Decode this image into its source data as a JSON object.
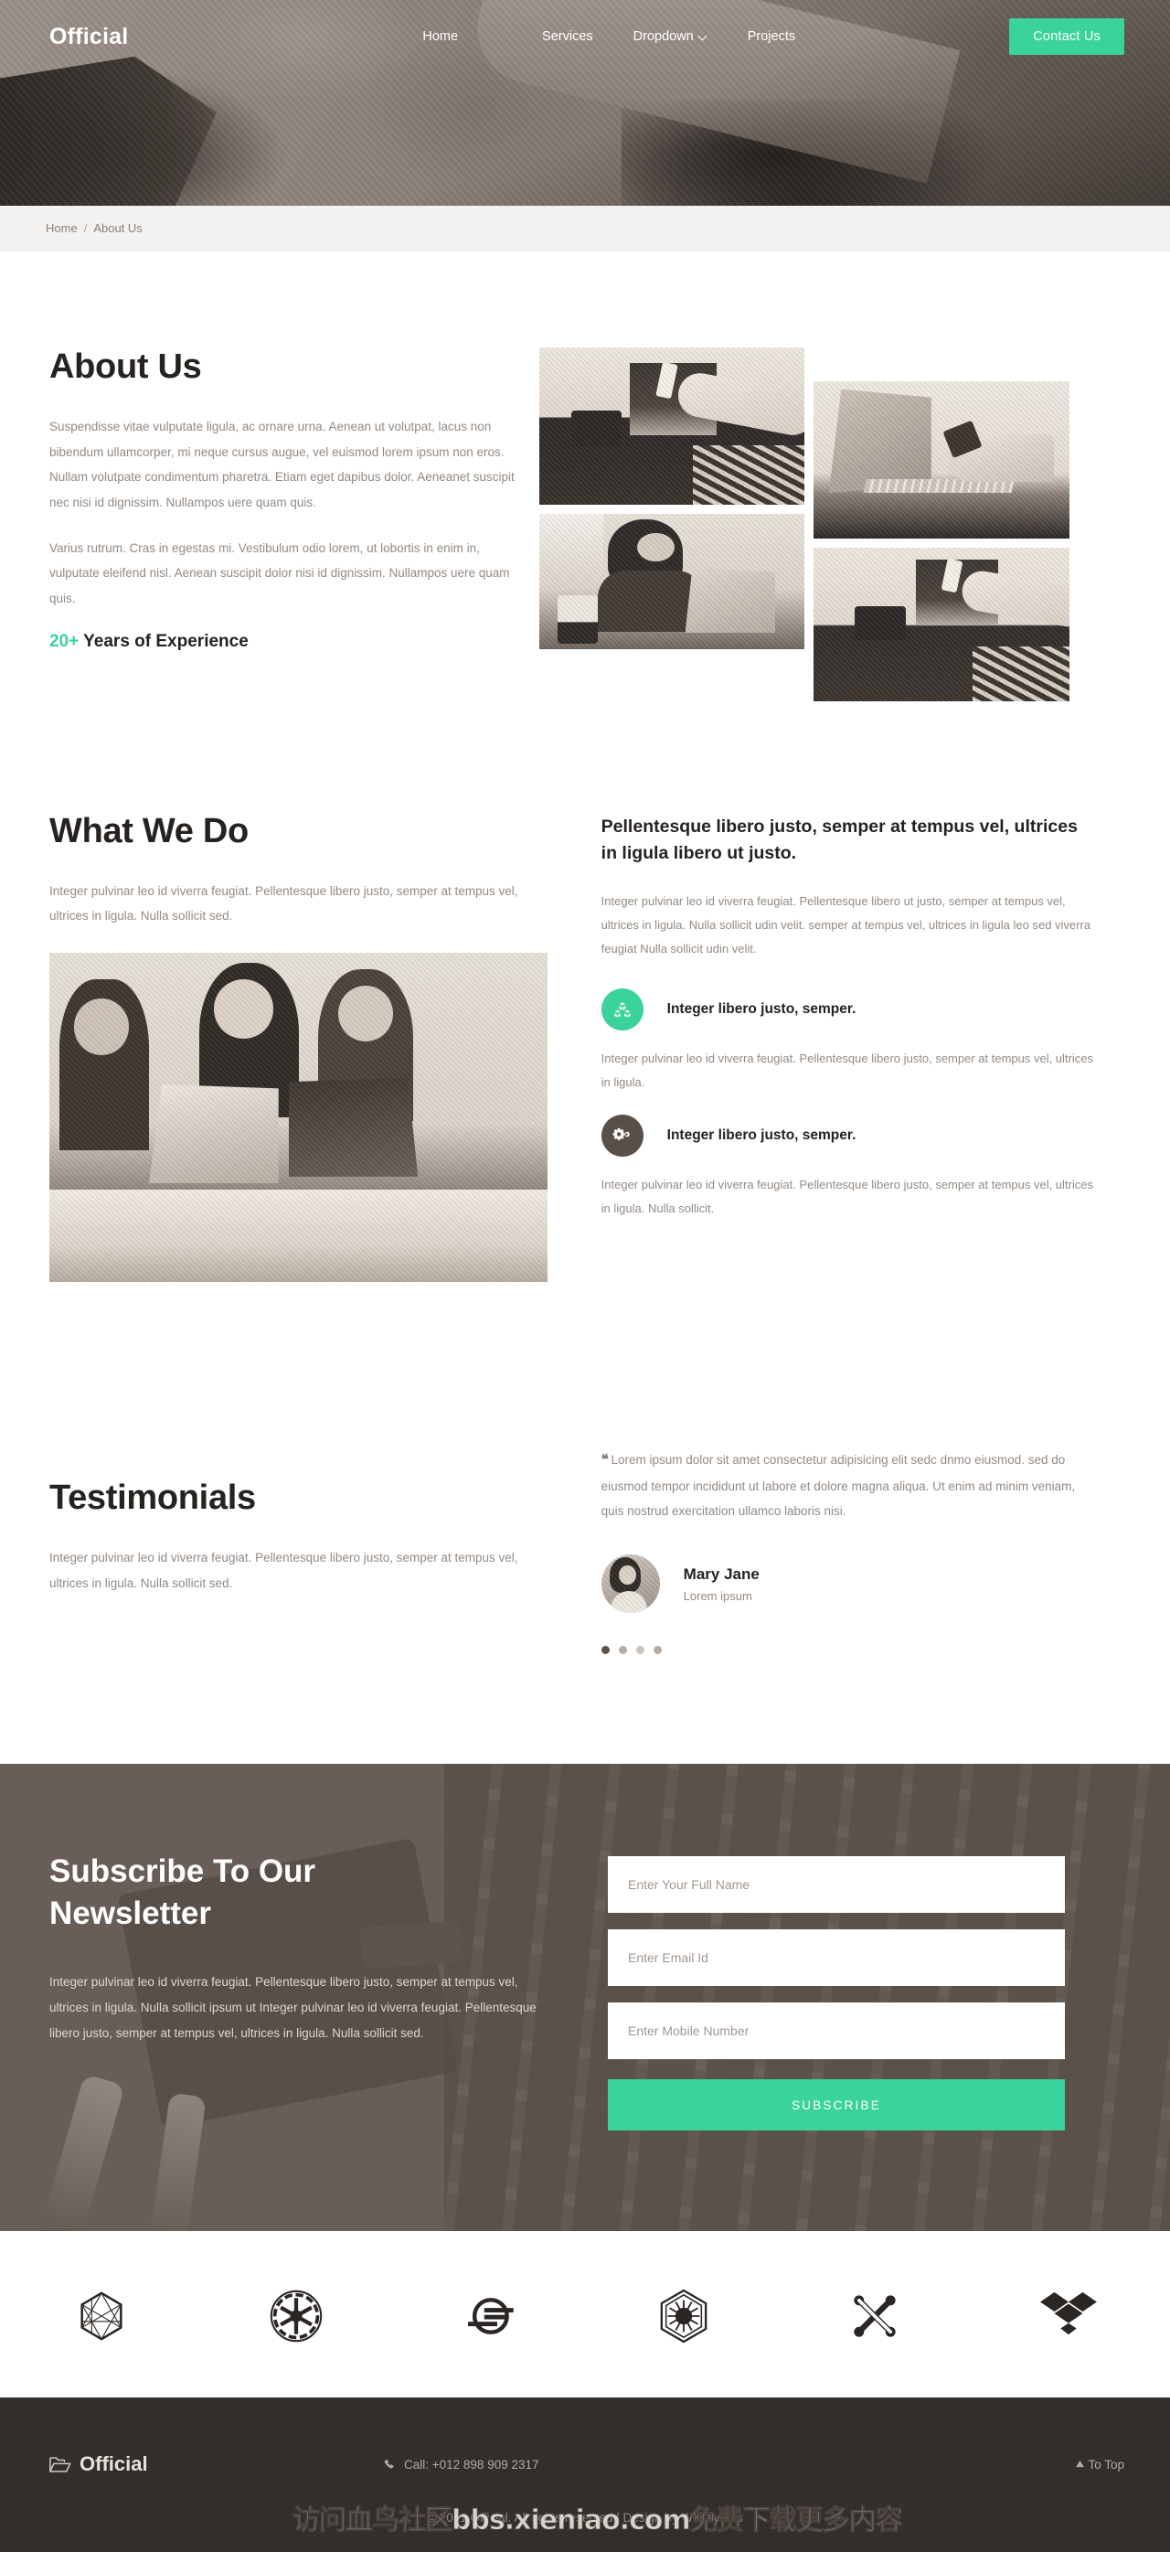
{
  "header": {
    "logo": "Official",
    "nav": [
      {
        "label": "Home",
        "icon": null
      },
      {
        "label": "Services",
        "icon": null
      },
      {
        "label": "Dropdown",
        "icon": "chevron-down-icon"
      },
      {
        "label": "Projects",
        "icon": null
      }
    ],
    "contact_label": "Contact Us"
  },
  "breadcrumb": {
    "home": "Home",
    "separator": "/",
    "current": "About Us"
  },
  "about": {
    "title": "About Us",
    "paragraph1": "Suspendisse vitae vulputate ligula, ac ornare urna. Aenean ut volutpat, lacus non bibendum ullamcorper, mi neque cursus augue, vel euismod lorem ipsum non eros. Nullam volutpate condimentum pharetra. Etiam eget dapibus dolor. Aeneanet suscipit nec nisi id dignissim. Nullampos uere quam quis.",
    "paragraph2": "Varius rutrum. Cras in egestas mi. Vestibulum odio lorem, ut lobortis in enim in, vulputate eleifend nisl. Aenean suscipit dolor nisi id dignissim. Nullampos uere quam quis.",
    "years_number": "20+",
    "years_label": "Years of Experience"
  },
  "what_we_do": {
    "title": "What We Do",
    "intro": "Integer pulvinar leo id viverra feugiat. Pellentesque libero justo, semper at tempus vel, ultrices in ligula. Nulla sollicit sed.",
    "lead": "Pellentesque libero justo, semper at tempus vel, ultrices in ligula libero ut justo.",
    "body": "Integer pulvinar leo id viverra feugiat. Pellentesque libero ut justo, semper at tempus vel, ultrices in ligula. Nulla sollicit udin velit. semper at tempus vel, ultrices in ligula leo sed viverra feugiat Nulla sollicit udin velit.",
    "features": [
      {
        "icon": "cubes-icon",
        "icon_color": "#3bd39c",
        "title": "Integer libero justo, semper.",
        "desc": "Integer pulvinar leo id viverra feugiat. Pellentesque libero justo, semper at tempus vel, ultrices in ligula."
      },
      {
        "icon": "cogs-icon",
        "icon_color": "#594f49",
        "title": "Integer libero justo, semper.",
        "desc": "Integer pulvinar leo id viverra feugiat. Pellentesque libero justo, semper at tempus vel, ultrices in ligula. Nulla sollicit."
      }
    ]
  },
  "testimonials": {
    "title": "Testimonials",
    "intro": "Integer pulvinar leo id viverra feugiat. Pellentesque libero justo, semper at tempus vel, ultrices in ligula. Nulla sollicit sed.",
    "quote_mark": "❝",
    "quote": "Lorem ipsum dolor sit amet consectetur adipisicing elit sedc dnmo eiusmod. sed do eiusmod tempor incididunt ut labore et dolore magna aliqua. Ut enim ad minim veniam, quis nostrud exercitation ullamco laboris nisi.",
    "author_name": "Mary Jane",
    "author_role": "Lorem ipsum",
    "dot_count": 4,
    "active_dot": 0
  },
  "newsletter": {
    "title": "Subscribe To Our Newsletter",
    "body": "Integer pulvinar leo id viverra feugiat. Pellentesque libero justo, semper at tempus vel, ultrices in ligula. Nulla sollicit ipsum ut Integer pulvinar leo id viverra feugiat. Pellentesque libero justo, semper at tempus vel, ultrices in ligula. Nulla sollicit sed.",
    "fields": [
      {
        "name": "full-name",
        "placeholder": "Enter Your Full Name",
        "value": ""
      },
      {
        "name": "email",
        "placeholder": "Enter Email Id",
        "value": ""
      },
      {
        "name": "mobile",
        "placeholder": "Enter Mobile Number",
        "value": ""
      }
    ],
    "submit_label": "SUBSCRIBE"
  },
  "brands": [
    {
      "name": "critical-role-icon"
    },
    {
      "name": "galactic-republic-icon"
    },
    {
      "name": "sistrix-icon"
    },
    {
      "name": "first-order-icon"
    },
    {
      "name": "joomla-icon"
    },
    {
      "name": "dropbox-icon"
    }
  ],
  "footer": {
    "logo": "Official",
    "logo_icon": "folder-open-icon",
    "phone_icon": "phone-icon",
    "phone_label": "Call: +012 898 909 2317",
    "to_top_label": "To Top",
    "to_top_icon": "caret-up-icon",
    "copyright": "© 2021 Official. All rights reserved | Design by W3Layouts"
  },
  "watermark": {
    "text": "访问血鸟社区bbs.xieniao.com免费下载更多内容"
  },
  "colors": {
    "accent": "#3bd39c",
    "dark": "#332e2b",
    "muted_text": "#948a83",
    "heading": "#262220"
  }
}
